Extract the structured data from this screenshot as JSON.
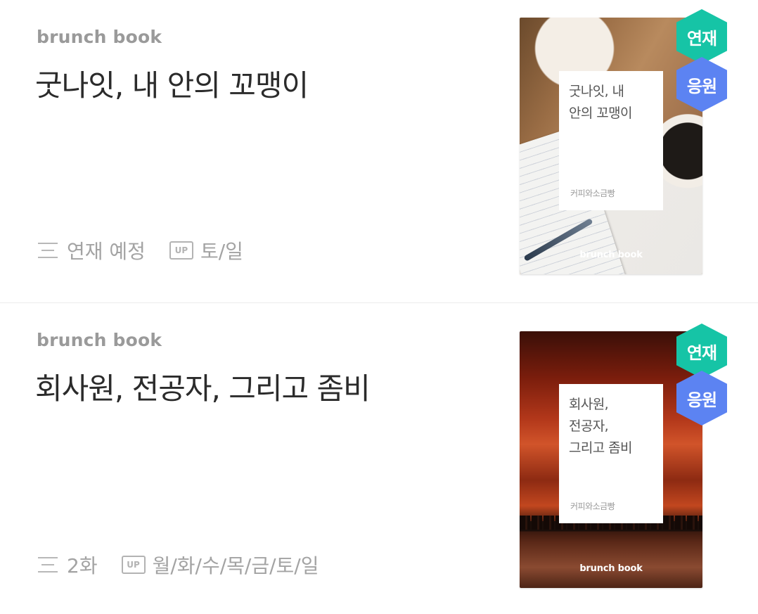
{
  "books": [
    {
      "kicker": "brunch book",
      "title": "굿나잇, 내 안의 꼬맹이",
      "status": "연재 예정",
      "up_label": "UP",
      "schedule": "토/일",
      "cover": {
        "title_lines": [
          "굿나잇, 내",
          "안의 꼬맹이"
        ],
        "author": "커피와소금빵",
        "brand": "brunch book"
      },
      "badges": {
        "series": "연재",
        "support": "응원"
      }
    },
    {
      "kicker": "brunch book",
      "title": "회사원, 전공자, 그리고 좀비",
      "status": "2화",
      "up_label": "UP",
      "schedule": "월/화/수/목/금/토/일",
      "cover": {
        "title_lines": [
          "회사원,",
          "전공자,",
          "그리고 좀비"
        ],
        "author": "커피와소금빵",
        "brand": "brunch book"
      },
      "badges": {
        "series": "연재",
        "support": "응원"
      }
    }
  ],
  "colors": {
    "series_badge": "#16c4a6",
    "support_badge": "#5c83f2",
    "title": "#2b2b2b",
    "muted": "#9a9a9a"
  },
  "icons": [
    "list-icon",
    "up-icon"
  ]
}
